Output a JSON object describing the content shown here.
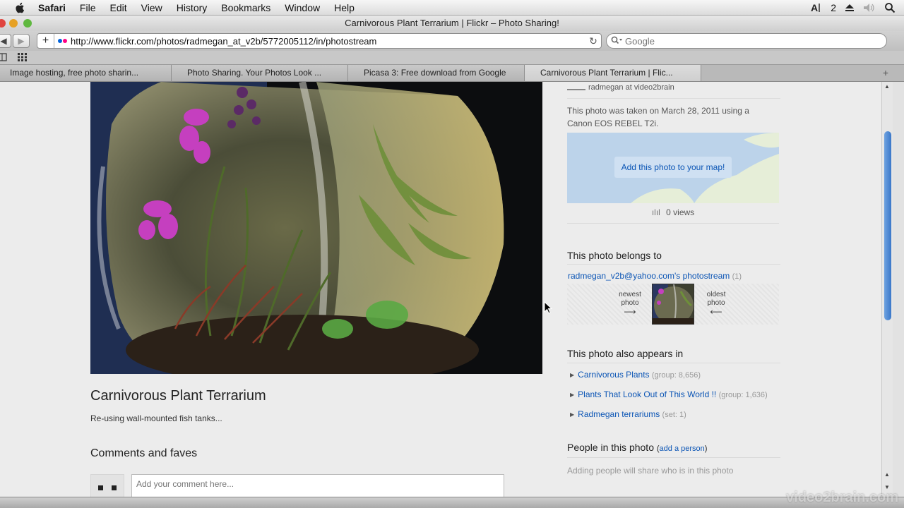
{
  "menubar": {
    "app": "Safari",
    "items": [
      "File",
      "Edit",
      "View",
      "History",
      "Bookmarks",
      "Window",
      "Help"
    ],
    "status_number": "2"
  },
  "window": {
    "title": "Carnivorous Plant Terrarium | Flickr – Photo Sharing!",
    "url": "http://www.flickr.com/photos/radmegan_at_v2b/5772005112/in/photostream",
    "search_placeholder": "Google"
  },
  "tabs": [
    {
      "label": "Image hosting, free photo sharin..."
    },
    {
      "label": "Photo Sharing. Your Photos Look ..."
    },
    {
      "label": "Picasa 3: Free download from Google"
    },
    {
      "label": "Carnivorous Plant Terrarium | Flic..."
    }
  ],
  "photo": {
    "title": "Carnivorous Plant Terrarium",
    "description": "Re-using wall-mounted fish tanks..."
  },
  "comments": {
    "heading": "Comments and faves",
    "placeholder": "Add your comment here..."
  },
  "sidebar": {
    "owner": "radmegan at video2brain",
    "taken": "This photo was taken on March 28, 2011 using a Canon EOS REBEL T2i.",
    "map_button": "Add this photo to your map!",
    "views": "0 views",
    "belongs_heading": "This photo belongs to",
    "photostream_link": "radmegan_v2b@yahoo.com's photostream",
    "photostream_count": "(1)",
    "newest": "newest photo",
    "oldest": "oldest photo",
    "newest_arrow": "⟶",
    "oldest_arrow": "⟵",
    "appears_heading": "This photo also appears in",
    "appears": [
      {
        "name": "Carnivorous Plants",
        "meta": "(group: 8,656)"
      },
      {
        "name": "Plants That Look Out of This World !!",
        "meta": "(group: 1,636)"
      },
      {
        "name": "Radmegan terrariums",
        "meta": "(set: 1)"
      }
    ],
    "people_heading": "People in this photo",
    "add_person": "add a person",
    "people_note": "Adding people will share who is in this photo"
  },
  "watermark": "video2brain.com",
  "colors": {
    "link": "#0b55b5",
    "flickr_blue": "#0063dc",
    "flickr_pink": "#ff0084",
    "scroll_thumb": "#3a78c9"
  }
}
